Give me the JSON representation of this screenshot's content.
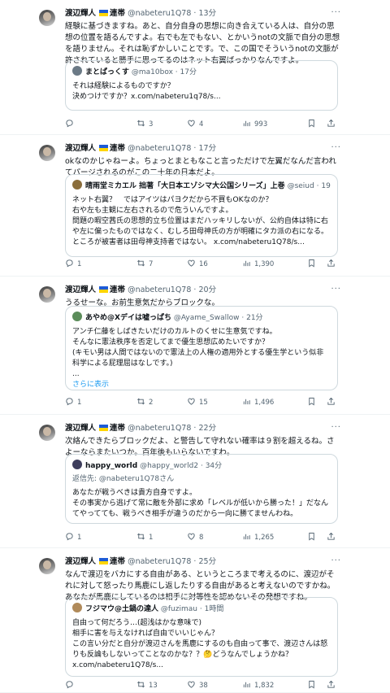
{
  "author": {
    "name": "渡辺輝人",
    "tag": "連帯",
    "handle": "@nabeteru1Q78",
    "verified_mark": "✓"
  },
  "tweets": [
    {
      "time": "13分",
      "text": "経験に基づきますね。あと、自分自身の思想に向き合えている人は、自分の思想の位置を語るんですよ。右でも左でもない、とかいうnotの文脈で自分の思想を語りません。それは恥ずかしいことです。で、この国でそういうnotの文脈が許されていると勝手に思ってるのはネット右翼ばっかりなんですよ。",
      "quote": {
        "name": "まとぱっくす",
        "handle": "@ma10box",
        "time": "17分",
        "text": "それは経験によるものですか？\n決めつけですか？x.com/nabeteru1q78/s..."
      },
      "reply": "",
      "retweets": "3",
      "likes": "4",
      "views": "993"
    },
    {
      "time": "17分",
      "text": "okなのかじゃねーよ。ちょっとまともなこと言っただけで左翼だなんだ言われてパージされるのがこの二十年の日本だよ。",
      "quote": {
        "name": "晴雨堂ミカエル 拙著「大日本エゾシマ大公国シリーズ」上巻",
        "handle": "@seiud",
        "time": "19分",
        "text": "ネット右翼？　ではアイツはパヨクだから不買もOKなのか？\n右や左も主観に左右されるので危ういんですよ。\n問題の暇空茜氏の思想的立ち位置はまだハッキリしないが、公約自体は特に右や左に偏ったものではなく、むしろ田母神氏の方が明確にタカ派の右になる。\nところが被害者は田母神支持者ではない。 x.com/nabeteru1Q78/s..."
      },
      "reply": "1",
      "retweets": "7",
      "likes": "16",
      "views": "1,390"
    },
    {
      "time": "20分",
      "text": "うるせーな。お前生意気だからブロックな。",
      "quote": {
        "name": "あやめ@Xデイは嘘っぱち",
        "handle": "@Ayame_Swallow",
        "time": "21分",
        "text": "アンチ仁藤をしばきたいだけのカルトのくせに生意気ですね。\nそんなに憲法秩序を否定してまで優生思想広めたいですか？\n(キモい男は人間ではないので憲法上の人権の適用外とする優生学という似非科学による屁理屈はなしです。)\n...",
        "more": "さらに表示"
      },
      "reply": "1",
      "retweets": "2",
      "likes": "15",
      "views": "1,496"
    },
    {
      "time": "22分",
      "text": "次絡んできたらブロックだよ、と警告して守れない確率は９割を超えるね。さよーならまたいつか。百年後もいらないですわ。",
      "quote": {
        "name": "happy_world",
        "handle": "@happy_world2",
        "time": "34分",
        "reply_to": "返信先: @nabeteru1Q78さん",
        "text": "あなたが戦うべきは貴方自身ですよ。\nその事実から逃げて常に敵を外部に求め「レベルが低いから勝った！」だなんてやってても、戦うべき相手が違うのだから一向に勝てませんわね。"
      },
      "reply": "1",
      "retweets": "1",
      "likes": "8",
      "views": "1,265"
    },
    {
      "time": "25分",
      "text": "なんで渡辺をバカにする自由がある、というところまで考えるのに、渡辺がそれに対して怒ったり馬鹿にし返したりする自由があると考えないのですかね。あなたが馬鹿にしているのは相手に対等性を認めないその発想ですね。",
      "quote": {
        "name": "フジマウ@土鍋の達人",
        "handle": "@fuzimau",
        "time": "1時間",
        "text": "自由って何だろう…(超浅はかな意味で)\n相手に害を与えなければ自由でいいじゃん？\nこの言い分だと自分が渡辺さんを馬鹿にするのも自由って事で、渡辺さんは怒りも反論もしないってことなのかな？？🤔どうなんでしょうかね？\nx.com/nabeteru1Q78/s..."
      },
      "reply": "",
      "retweets": "13",
      "likes": "38",
      "views": "1,832"
    }
  ]
}
